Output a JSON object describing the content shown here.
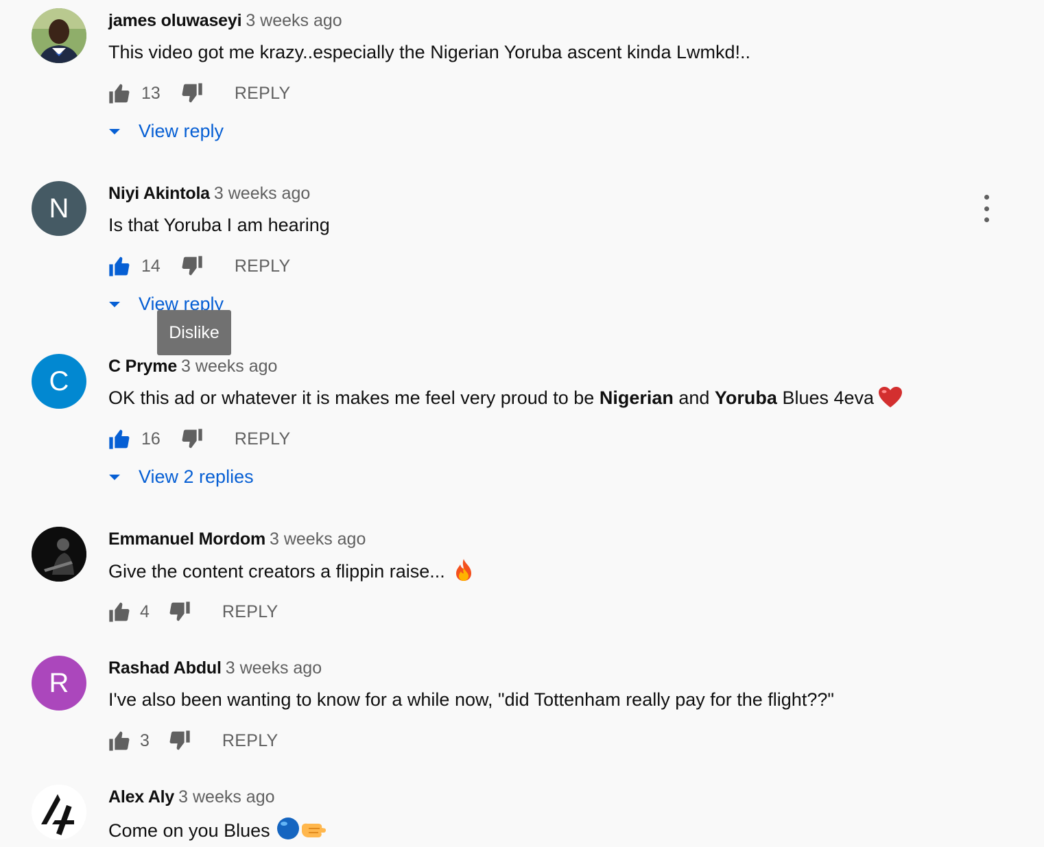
{
  "colors": {
    "background": "#f9f9f9",
    "link": "#065fd4",
    "muted": "#606060",
    "liked": "#065fd4",
    "tooltip_bg": "#717171"
  },
  "comments": [
    {
      "author": "james oluwaseyi",
      "time": "3 weeks ago",
      "text": "This video got me krazy..especially the Nigerian Yoruba ascent kinda Lwmkd!..",
      "likes": "13",
      "reply_label": "REPLY",
      "view_replies": "View reply",
      "avatar": "photo",
      "liked": false
    },
    {
      "author": "Niyi Akintola",
      "time": "3 weeks ago",
      "text": "Is that Yoruba I am hearing",
      "likes": "14",
      "reply_label": "REPLY",
      "view_replies": "View reply",
      "avatar_letter": "N",
      "avatar_color": "#455a64",
      "liked": true
    },
    {
      "author": "C Pryme",
      "time": "3 weeks ago",
      "text_parts": [
        "OK this ad or whatever it is makes me feel very proud to be ",
        "Nigerian",
        " and ",
        "Yoruba",
        " Blues 4eva"
      ],
      "emoji": "red-heart",
      "likes": "16",
      "reply_label": "REPLY",
      "view_replies": "View 2 replies",
      "avatar_letter": "C",
      "avatar_color": "#0288d1",
      "liked": true
    },
    {
      "author": "Emmanuel Mordom",
      "time": "3 weeks ago",
      "text": "Give the content creators a flippin raise...",
      "emoji": "fire",
      "likes": "4",
      "reply_label": "REPLY",
      "avatar": "photo-dark",
      "liked": false
    },
    {
      "author": "Rashad Abdul",
      "time": "3 weeks ago",
      "text": "I've also been wanting to know for a while now, \"did Tottenham really pay for the flight??\"",
      "likes": "3",
      "reply_label": "REPLY",
      "avatar_letter": "R",
      "avatar_color": "#ab47bc",
      "liked": false
    },
    {
      "author": "Alex Aly",
      "time": "3 weeks ago",
      "text": "Come on you Blues",
      "emoji": "blue-circle-fist",
      "avatar": "logo"
    }
  ],
  "tooltip": {
    "label": "Dislike"
  }
}
